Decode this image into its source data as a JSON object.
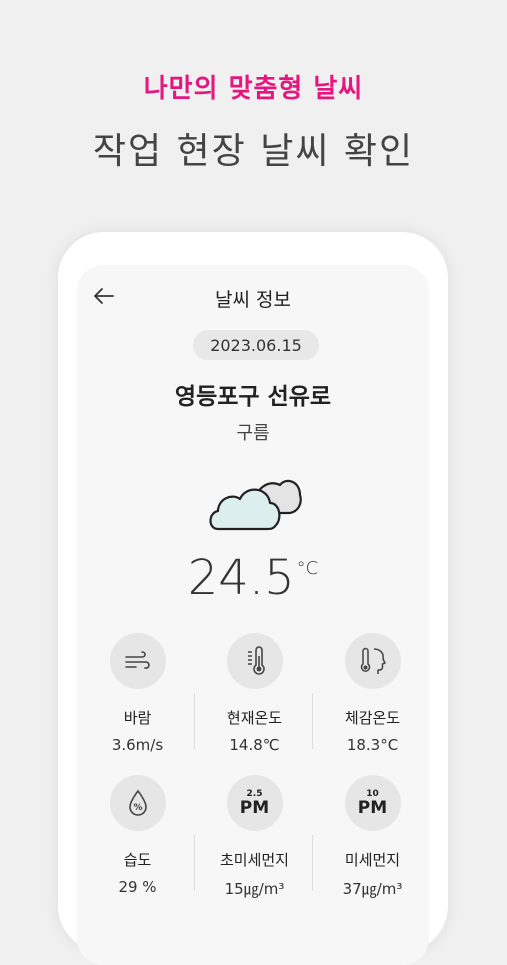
{
  "promo": {
    "tagline": "나만의 맞춤형 날씨",
    "title": "작업 현장 날씨 확인"
  },
  "header": {
    "title": "날씨 정보",
    "back_icon": "back-arrow-icon"
  },
  "weather": {
    "date": "2023.06.15",
    "location": "영등포구 선유로",
    "condition": "구름",
    "condition_icon": "cloudy-icon",
    "temperature": "24.5",
    "temperature_unit": "°C"
  },
  "metrics": [
    {
      "label": "바람",
      "value": "3.6m/s",
      "icon": "wind-icon"
    },
    {
      "label": "현재온도",
      "value": "14.8℃",
      "icon": "thermometer-icon"
    },
    {
      "label": "체감온도",
      "value": "18.3°C",
      "icon": "feels-like-icon"
    },
    {
      "label": "습도",
      "value": "29 %",
      "icon": "humidity-drop-icon"
    },
    {
      "label": "초미세먼지",
      "value": "15㎍/m³",
      "icon": "pm25-icon",
      "icon_top": "2.5",
      "icon_text": "PM"
    },
    {
      "label": "미세먼지",
      "value": "37㎍/m³",
      "icon": "pm10-icon",
      "icon_top": "10",
      "icon_text": "PM"
    }
  ],
  "colors": {
    "accent": "#e5177e",
    "background": "#f0f0f0",
    "screen": "#f7f7f7",
    "icon_circle": "#e6e6e6"
  }
}
